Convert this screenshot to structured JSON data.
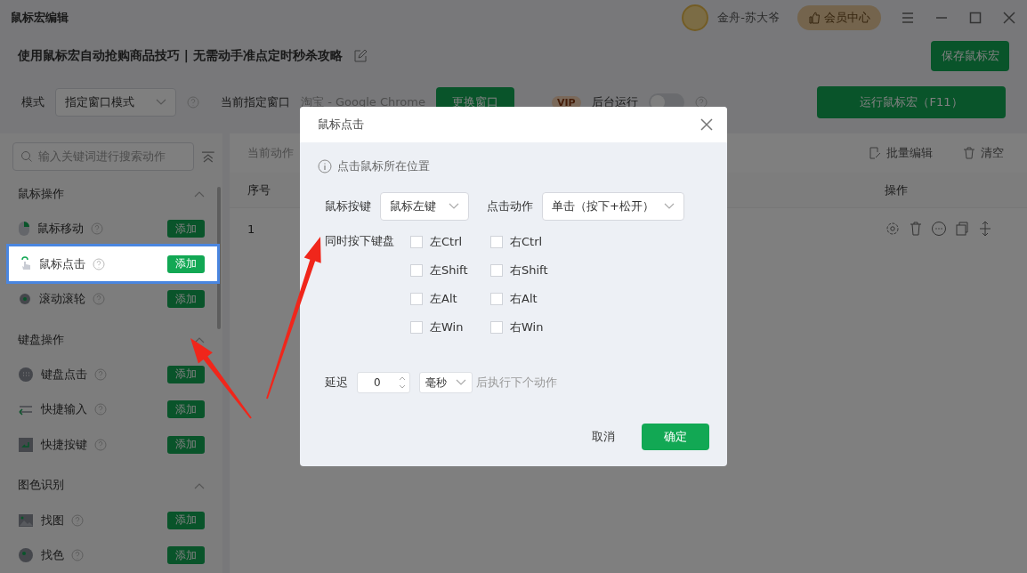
{
  "window": {
    "title": "鼠标宏编辑",
    "user": "金舟-苏大爷",
    "vip_button": "会员中心"
  },
  "header": {
    "title": "使用鼠标宏自动抢购商品技巧 | 无需动手准点定时秒杀攻略",
    "save_button": "保存鼠标宏"
  },
  "toolbar": {
    "mode_label": "模式",
    "mode_value": "指定窗口模式",
    "window_label": "当前指定窗口",
    "window_value": "淘宝 - Google Chrome",
    "change_button": "更换窗口",
    "vip_badge": "VIP",
    "background_label": "后台运行",
    "background_on": false,
    "run_button": "运行鼠标宏（F11）"
  },
  "sidebar": {
    "search_placeholder": "输入关键词进行搜索动作",
    "sections": [
      {
        "title": "鼠标操作",
        "expanded": true,
        "items": [
          {
            "label": "鼠标移动",
            "kind": "mouse",
            "button": "添加",
            "selected": false
          },
          {
            "label": "鼠标点击",
            "kind": "click",
            "button": "添加",
            "selected": true
          },
          {
            "label": "滚动滚轮",
            "kind": "wheel",
            "button": "添加",
            "selected": false
          }
        ]
      },
      {
        "title": "键盘操作",
        "expanded": true,
        "items": [
          {
            "label": "键盘点击",
            "kind": "keypad",
            "button": "添加",
            "selected": false
          },
          {
            "label": "快捷输入",
            "kind": "input",
            "button": "添加",
            "selected": false
          },
          {
            "label": "快捷按键",
            "kind": "enter",
            "button": "添加",
            "selected": false
          }
        ]
      },
      {
        "title": "图色识别",
        "expanded": true,
        "items": [
          {
            "label": "找图",
            "kind": "image",
            "button": "添加",
            "selected": false
          },
          {
            "label": "找色",
            "kind": "color",
            "button": "添加",
            "selected": false
          }
        ]
      }
    ]
  },
  "table": {
    "count_label": "当前动作",
    "batch_edit": "批量编辑",
    "clear": "清空",
    "columns": [
      "序号",
      "操作"
    ],
    "rows": [
      {
        "index": "1"
      }
    ]
  },
  "dialog": {
    "title": "鼠标点击",
    "hint": "点击鼠标所在位置",
    "button_label": "鼠标按键",
    "button_value": "鼠标左键",
    "action_label": "点击动作",
    "action_value": "单击（按下+松开）",
    "keys_label": "同时按下键盘",
    "keys": [
      {
        "label": "左Ctrl",
        "checked": false
      },
      {
        "label": "右Ctrl",
        "checked": false
      },
      {
        "label": "左Shift",
        "checked": false
      },
      {
        "label": "右Shift",
        "checked": false
      },
      {
        "label": "左Alt",
        "checked": false
      },
      {
        "label": "右Alt",
        "checked": false
      },
      {
        "label": "左Win",
        "checked": false
      },
      {
        "label": "右Win",
        "checked": false
      }
    ],
    "delay_label": "延迟",
    "delay_value": "0",
    "delay_unit": "毫秒",
    "delay_suffix": "后执行下个动作",
    "cancel": "取消",
    "confirm": "确定"
  }
}
